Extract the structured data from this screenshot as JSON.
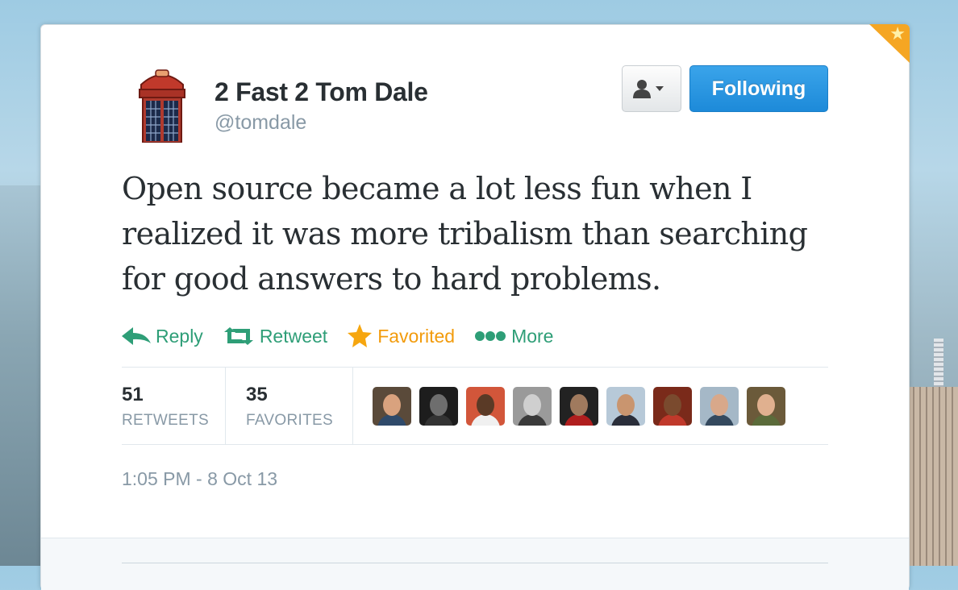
{
  "tweet": {
    "user": {
      "name": "2 Fast 2 Tom Dale",
      "handle": "@tomdale",
      "avatar_icon": "phone-booth-avatar"
    },
    "buttons": {
      "user_menu_icon": "person-dropdown-icon",
      "follow_label": "Following"
    },
    "text": "Open source became a lot less fun when I realized it was more tribalism than searching for good answers to hard problems.",
    "actions": [
      {
        "label": "Reply",
        "icon": "reply-arrow-icon"
      },
      {
        "label": "Retweet",
        "icon": "retweet-icon"
      },
      {
        "label": "Favorited",
        "icon": "star-icon"
      },
      {
        "label": "More",
        "icon": "more-dots-icon"
      }
    ],
    "stats": {
      "retweets": {
        "count": "51",
        "label": "RETWEETS"
      },
      "favorites": {
        "count": "35",
        "label": "FAVORITES"
      }
    },
    "favoriters": [
      {
        "bg": "#5a4a3a",
        "skin": "#d9a27e",
        "shirt": "#2f4a6a"
      },
      {
        "bg": "#1d1d1d",
        "skin": "#6e6e6e",
        "shirt": "#333333"
      },
      {
        "bg": "#d2563a",
        "skin": "#5a3a26",
        "shirt": "#f0f0f0"
      },
      {
        "bg": "#9a9a9a",
        "skin": "#cfcfcf",
        "shirt": "#3a3a3a"
      },
      {
        "bg": "#222222",
        "skin": "#a07a5e",
        "shirt": "#b01e1e"
      },
      {
        "bg": "#b7c9d8",
        "skin": "#c9956f",
        "shirt": "#2a2e3a"
      },
      {
        "bg": "#7a2a1a",
        "skin": "#7a4a2e",
        "shirt": "#c0392b"
      },
      {
        "bg": "#a5b8c7",
        "skin": "#d8a88a",
        "shirt": "#34495e"
      },
      {
        "bg": "#6b5a3a",
        "skin": "#e0b08f",
        "shirt": "#5b6b3a"
      }
    ],
    "timestamp": "1:05 PM - 8 Oct 13",
    "colors": {
      "accent": "#2e9e77",
      "favorited": "#f29b0c",
      "follow_button": "#1d8ad9"
    }
  }
}
